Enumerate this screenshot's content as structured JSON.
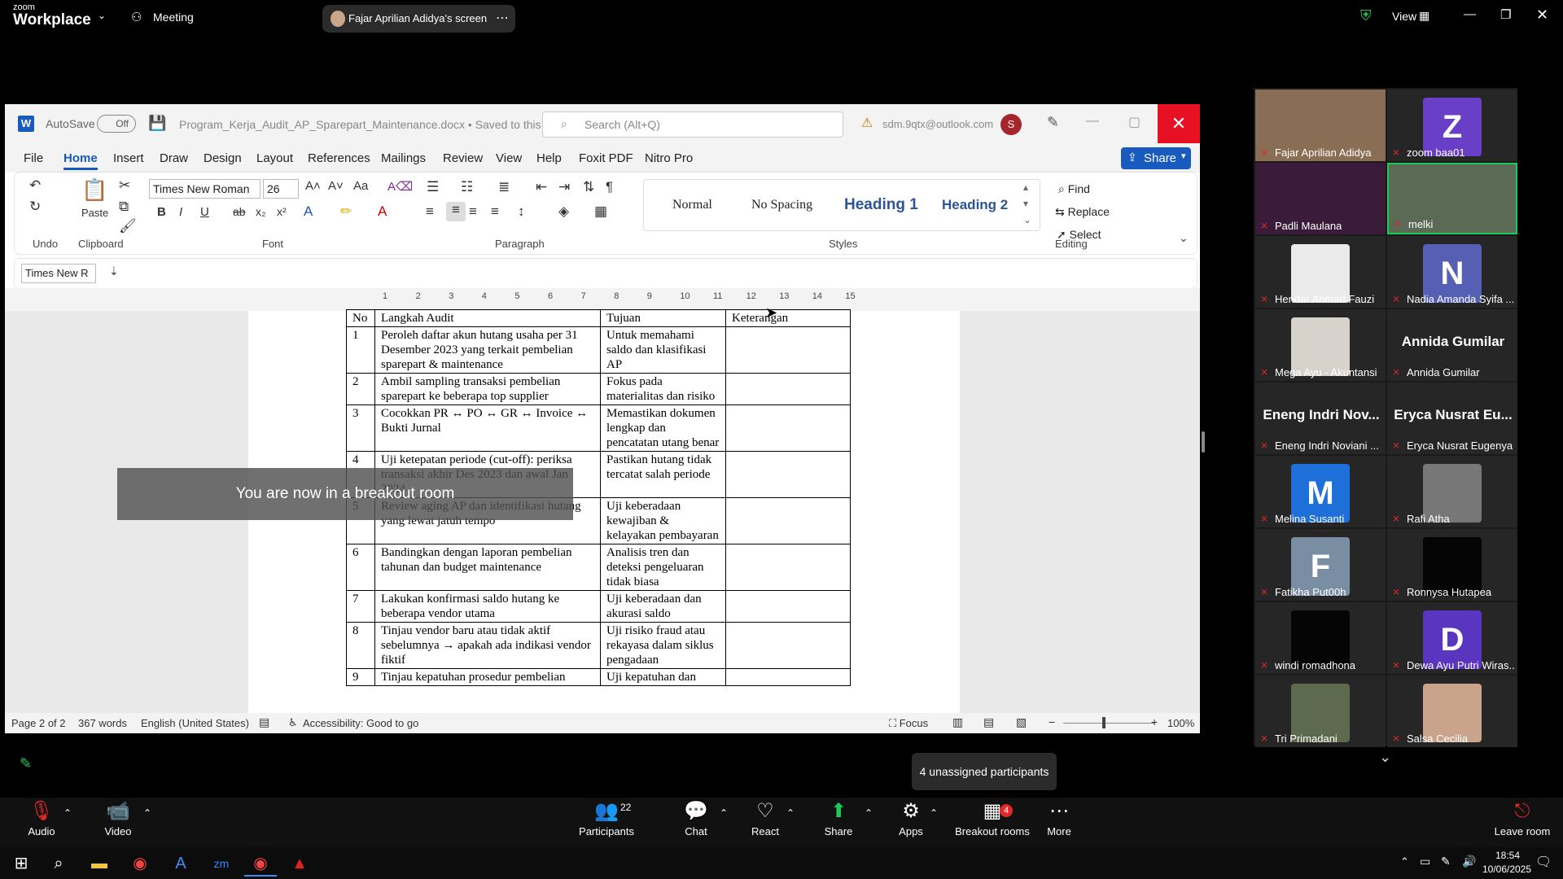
{
  "zoom": {
    "logo_small": "zoom",
    "logo_big": "Workplace",
    "meeting_label": "Meeting",
    "screen_share_label": "Fajar Aprilian Adidya's screen",
    "view_label": "View",
    "unassigned_label": "4 unassigned participants",
    "breakout_toast": "You are now in a breakout room",
    "participant_count": "22",
    "breakout_badge": "4",
    "toolbar": {
      "audio": "Audio",
      "video": "Video",
      "participants": "Participants",
      "chat": "Chat",
      "react": "React",
      "share": "Share",
      "apps": "Apps",
      "breakout_rooms": "Breakout rooms",
      "more": "More",
      "leave_room": "Leave room"
    },
    "participants": [
      {
        "name": "Fajar Aprilian Adidya",
        "avatar_letter": "",
        "avatar_color": "#8a6d55"
      },
      {
        "name": "zoom baa01",
        "avatar_letter": "Z",
        "avatar_color": "#6a3fc7"
      },
      {
        "name": "Padli Maulana",
        "avatar_letter": "",
        "avatar_color": "#3a1c3a"
      },
      {
        "name": "melki",
        "avatar_letter": "",
        "avatar_color": "#5a6a55"
      },
      {
        "name": "Hendar Ahmad Fauzi",
        "avatar_letter": "",
        "avatar_color": "#eaeaea"
      },
      {
        "name": "Nadia Amanda Syifa ...",
        "avatar_letter": "N",
        "avatar_color": "#5560b5"
      },
      {
        "name": "Mega Ayu - Akuntansi",
        "avatar_letter": "",
        "avatar_color": "#d8d2cc"
      },
      {
        "name": "Annida Gumilar",
        "avatar_letter": "",
        "avatar_color": "",
        "big_name": "Annida Gumilar"
      },
      {
        "name": "Eneng Indri Noviani ...",
        "avatar_letter": "",
        "avatar_color": "",
        "big_name": "Eneng Indri Nov..."
      },
      {
        "name": "Eryca Nusrat Eugenya",
        "avatar_letter": "",
        "avatar_color": "",
        "big_name": "Eryca Nusrat Eu..."
      },
      {
        "name": "Melina Susanti",
        "avatar_letter": "M",
        "avatar_color": "#1e6fd9"
      },
      {
        "name": "Rafi Atha",
        "avatar_letter": "",
        "avatar_color": "#777777"
      },
      {
        "name": "Fatikha Put00h",
        "avatar_letter": "F",
        "avatar_color": "#7a8ea3"
      },
      {
        "name": "Ronnysa Hutapea",
        "avatar_letter": "",
        "avatar_color": "#050505"
      },
      {
        "name": "windi romadhona",
        "avatar_letter": "",
        "avatar_color": "#050505"
      },
      {
        "name": "Dewa Ayu Putri Wiras...",
        "avatar_letter": "D",
        "avatar_color": "#5a36c0"
      },
      {
        "name": "Tri Primadani",
        "avatar_letter": "",
        "avatar_color": "#5d6a4e"
      },
      {
        "name": "Salsa Cecilia",
        "avatar_letter": "",
        "avatar_color": "#c9a38a"
      }
    ]
  },
  "word": {
    "autosave_label": "AutoSave",
    "autosave_state": "Off",
    "doc_title": "Program_Kerja_Audit_AP_Sparepart_Maintenance.docx • Saved to this PC",
    "search_placeholder": "Search (Alt+Q)",
    "account": "sdm.9qtx@outlook.com",
    "account_initial": "S",
    "share_label": "Share",
    "tabs": [
      "File",
      "Home",
      "Insert",
      "Draw",
      "Design",
      "Layout",
      "References",
      "Mailings",
      "Review",
      "View",
      "Help",
      "Foxit PDF",
      "Nitro Pro"
    ],
    "font_name": "Times New Roman",
    "font_size": "26",
    "style_font_box": "Times New R",
    "groups": [
      "Undo",
      "Clipboard",
      "Font",
      "Paragraph",
      "Styles",
      "Editing"
    ],
    "paste_label": "Paste",
    "styles": [
      "Normal",
      "No Spacing",
      "Heading 1",
      "Heading 2"
    ],
    "editing": [
      "Find",
      "Replace",
      "Select"
    ],
    "ruler_numbers": [
      "1",
      "2",
      "3",
      "4",
      "5",
      "6",
      "7",
      "8",
      "9",
      "10",
      "11",
      "12",
      "13",
      "14",
      "15"
    ],
    "status": {
      "page": "Page 2 of 2",
      "words": "367 words",
      "language": "English (United States)",
      "accessibility": "Accessibility: Good to go",
      "focus": "Focus",
      "zoom": "100%"
    },
    "table": {
      "headers": [
        "No",
        "Langkah Audit",
        "Tujuan",
        "Keterangan"
      ],
      "rows": [
        [
          "1",
          "Peroleh daftar akun hutang usaha per 31 Desember 2023 yang terkait pembelian sparepart & maintenance",
          "Untuk memahami saldo dan klasifikasi AP",
          ""
        ],
        [
          "2",
          "Ambil sampling transaksi pembelian sparepart ke beberapa top supplier",
          "Fokus pada materialitas dan risiko",
          ""
        ],
        [
          "3",
          "Cocokkan PR ↔ PO ↔ GR ↔ Invoice ↔ Bukti Jurnal",
          "Memastikan dokumen lengkap dan pencatatan utang benar",
          ""
        ],
        [
          "4",
          "Uji ketepatan periode (cut-off): periksa transaksi akhir Des 2023 dan awal Jan 2024",
          "Pastikan hutang tidak tercatat salah periode",
          ""
        ],
        [
          "5",
          "Review aging AP dan identifikasi hutang yang lewat jatuh tempo",
          "Uji keberadaan kewajiban & kelayakan pembayaran",
          ""
        ],
        [
          "6",
          "Bandingkan dengan laporan pembelian tahunan dan budget maintenance",
          "Analisis tren dan deteksi pengeluaran tidak biasa",
          ""
        ],
        [
          "7",
          "Lakukan konfirmasi saldo hutang ke beberapa vendor utama",
          "Uji keberadaan dan akurasi saldo",
          ""
        ],
        [
          "8",
          "Tinjau vendor baru atau tidak aktif sebelumnya → apakah ada indikasi vendor fiktif",
          "Uji risiko fraud atau rekayasa dalam siklus pengadaan",
          ""
        ],
        [
          "9",
          "Tinjau kepatuhan prosedur pembelian",
          "Uji kepatuhan dan",
          ""
        ]
      ]
    }
  },
  "taskbar": {
    "time": "18:54",
    "date": "10/06/2025"
  },
  "colors": {
    "word_blue": "#185abd",
    "close_red": "#e81123",
    "zoom_green": "#1ec95b",
    "mic_red": "#e02828"
  }
}
